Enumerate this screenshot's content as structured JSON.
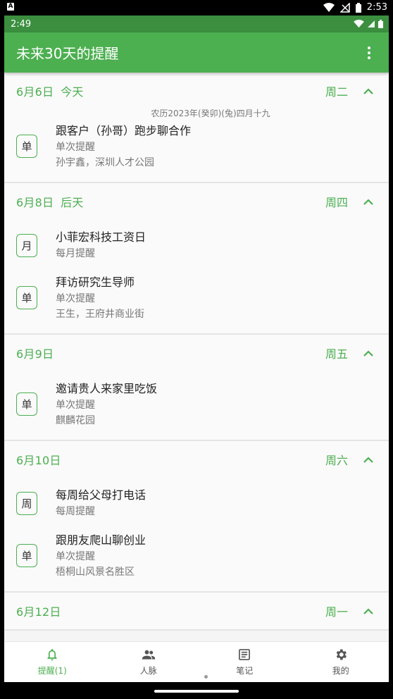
{
  "system_bar": {
    "time": "2:53"
  },
  "app_status": {
    "time": "2:49"
  },
  "appbar": {
    "title": "未来30天的提醒"
  },
  "sections": [
    {
      "date": "6月6日",
      "relative": "今天",
      "weekday": "周二",
      "lunar": "农历2023年(癸卯)(兔)四月十九",
      "items": [
        {
          "badge": "单",
          "title": "跟客户（孙哥）跑步聊合作",
          "type": "单次提醒",
          "detail": "孙宇鑫，深圳人才公园"
        }
      ]
    },
    {
      "date": "6月8日",
      "relative": "后天",
      "weekday": "周四",
      "items": [
        {
          "badge": "月",
          "title": "小菲宏科技工资日",
          "type": "每月提醒"
        },
        {
          "badge": "单",
          "title": "拜访研究生导师",
          "type": "单次提醒",
          "detail": "王生，王府井商业街"
        }
      ]
    },
    {
      "date": "6月9日",
      "weekday": "周五",
      "items": [
        {
          "badge": "单",
          "title": "邀请贵人来家里吃饭",
          "type": "单次提醒",
          "detail": "麒麟花园"
        }
      ]
    },
    {
      "date": "6月10日",
      "weekday": "周六",
      "items": [
        {
          "badge": "周",
          "title": "每周给父母打电话",
          "type": "每周提醒"
        },
        {
          "badge": "单",
          "title": "跟朋友爬山聊创业",
          "type": "单次提醒",
          "detail": "梧桐山风景名胜区"
        }
      ]
    },
    {
      "date": "6月12日",
      "weekday": "周一",
      "items": []
    }
  ],
  "nav": [
    {
      "label": "提醒(1)",
      "icon": "bell-icon",
      "active": true
    },
    {
      "label": "人脉",
      "icon": "people-icon"
    },
    {
      "label": "笔记",
      "icon": "note-icon"
    },
    {
      "label": "我的",
      "icon": "gear-icon"
    }
  ],
  "colors": {
    "primary": "#4caf50",
    "primary_dark": "#3b8f3f"
  }
}
